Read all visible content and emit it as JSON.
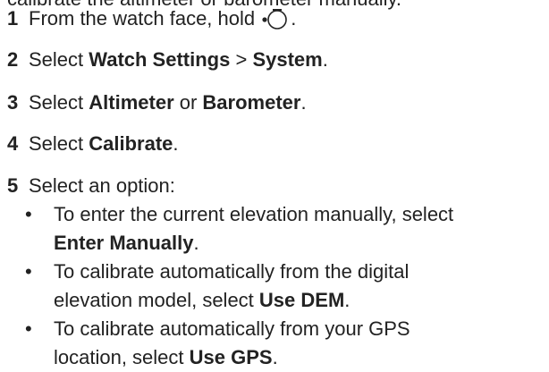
{
  "cut_line": "calibrate the altimeter or barometer manually.",
  "steps": [
    {
      "num": "1",
      "pre": "From the watch face, hold ",
      "icon": "watch-button-icon",
      "post": "."
    },
    {
      "num": "2",
      "pre": "Select ",
      "b1": "Watch Settings",
      "mid": " > ",
      "b2": "System",
      "post": "."
    },
    {
      "num": "3",
      "pre": "Select ",
      "b1": "Altimeter",
      "mid": " or ",
      "b2": "Barometer",
      "post": "."
    },
    {
      "num": "4",
      "pre": "Select ",
      "b1": "Calibrate",
      "post": "."
    },
    {
      "num": "5",
      "text": "Select an option:"
    }
  ],
  "options": [
    {
      "line1": "To enter the current elevation manually, select",
      "bold": "Enter Manually",
      "post": "."
    },
    {
      "line1": "To calibrate automatically from the digital",
      "line2_pre": "elevation model, select ",
      "bold": "Use DEM",
      "post": "."
    },
    {
      "line1": "To calibrate automatically from your GPS",
      "line2_pre": "location, select ",
      "bold": "Use GPS",
      "post": "."
    }
  ],
  "bullet_char": "•"
}
